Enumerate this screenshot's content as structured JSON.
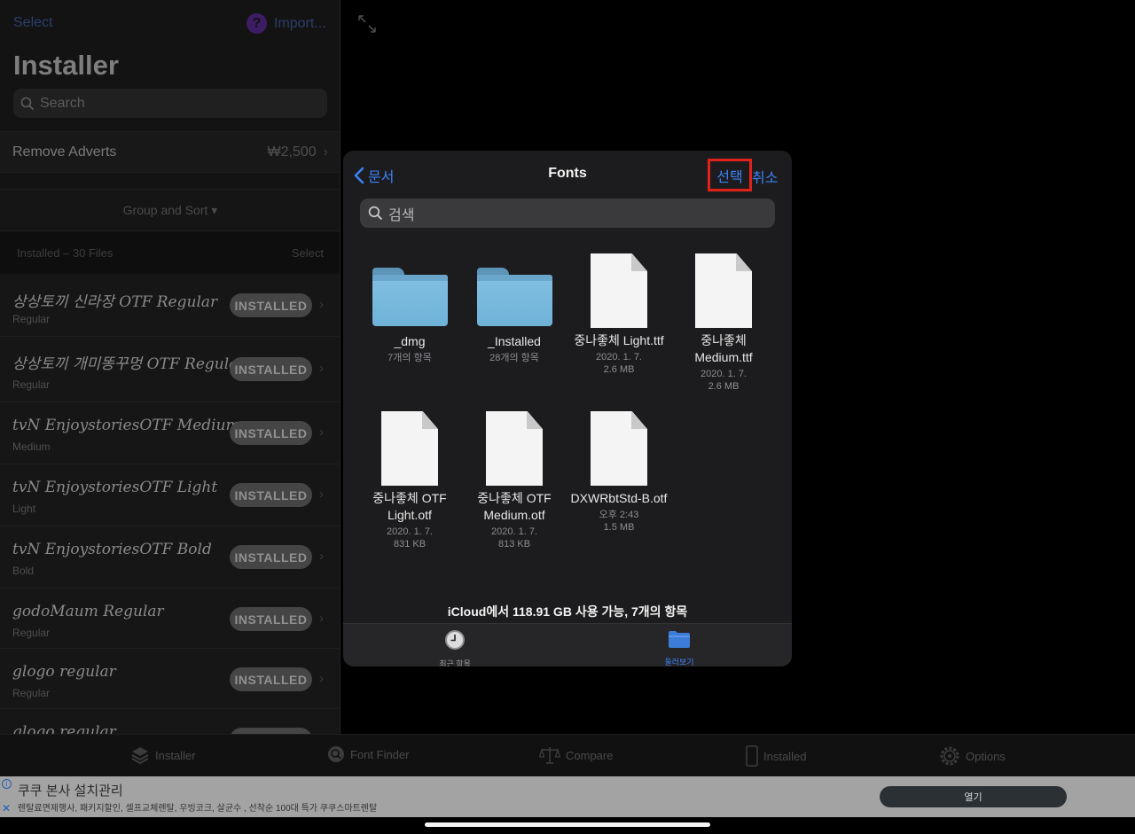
{
  "left_panel": {
    "select_label": "Select",
    "import_label": "Import...",
    "import_icon_glyph": "?",
    "title": "Installer",
    "search_placeholder": "Search",
    "remove_ads": {
      "label": "Remove Adverts",
      "price": "₩2,500"
    },
    "group_sort_label": "Group and Sort ▾",
    "files_header": {
      "count_label": "Installed – 30 Files",
      "select_label": "Select"
    },
    "fonts": [
      {
        "name": "상상토끼 신라장 OTF Regular",
        "style": "Regular",
        "status": "INSTALLED"
      },
      {
        "name": "상상토끼 개미똥꾸멍 OTF Regular",
        "style": "Regular",
        "status": "INSTALLED"
      },
      {
        "name": "tvN EnjoystoriesOTF Medium",
        "style": "Medium",
        "status": "INSTALLED"
      },
      {
        "name": "tvN EnjoystoriesOTF Light",
        "style": "Light",
        "status": "INSTALLED"
      },
      {
        "name": "tvN EnjoystoriesOTF Bold",
        "style": "Bold",
        "status": "INSTALLED"
      },
      {
        "name": "godoMaum Regular",
        "style": "Regular",
        "status": "INSTALLED"
      },
      {
        "name": "glogo regular",
        "style": "Regular",
        "status": "INSTALLED"
      },
      {
        "name": "glogo regular",
        "style": "",
        "status": ""
      }
    ]
  },
  "dialog": {
    "back_label": "문서",
    "title": "Fonts",
    "select_label": "선택",
    "cancel_label": "취소",
    "search_placeholder": "검색",
    "items": [
      {
        "kind": "folder",
        "name": "_dmg",
        "meta1": "7개의 항목",
        "meta2": ""
      },
      {
        "kind": "folder",
        "name": "_Installed",
        "meta1": "28개의 항목",
        "meta2": ""
      },
      {
        "kind": "file",
        "name": "중나좋체 Light.ttf",
        "meta1": "2020. 1. 7.",
        "meta2": "2.6 MB"
      },
      {
        "kind": "file",
        "name": "중나좋체 Medium.ttf",
        "meta1": "2020. 1. 7.",
        "meta2": "2.6 MB"
      },
      {
        "kind": "file",
        "name": "중나좋체 OTF Light.otf",
        "meta1": "2020. 1. 7.",
        "meta2": "831 KB"
      },
      {
        "kind": "file",
        "name": "중나좋체 OTF Medium.otf",
        "meta1": "2020. 1. 7.",
        "meta2": "813 KB"
      },
      {
        "kind": "file",
        "name": "DXWRbtStd-B.otf",
        "meta1": "오후 2:43",
        "meta2": "1.5 MB"
      }
    ],
    "storage_text": "iCloud에서 118.91 GB 사용 가능, 7개의 항목",
    "tabs": [
      {
        "label": "최근 항목",
        "icon": "clock-icon"
      },
      {
        "label": "둘러보기",
        "icon": "folder-icon"
      }
    ]
  },
  "app_tabbar": [
    {
      "label": "Installer",
      "icon": "layers-icon"
    },
    {
      "label": "Font Finder",
      "icon": "search-icon"
    },
    {
      "label": "Compare",
      "icon": "scale-icon"
    },
    {
      "label": "Installed",
      "icon": "device-icon"
    },
    {
      "label": "Options",
      "icon": "gear-icon"
    }
  ],
  "ad": {
    "title": "쿠쿠 본사 설치관리",
    "description": "렌탈료면제행사, 패키지할인, 셀프교체렌탈, 우빙코크, 살균수 , 선착순 100대 특가 쿠쿠스마트렌탈",
    "open_label": "열기",
    "close_glyph": "✕",
    "info_glyph": "i"
  },
  "colors": {
    "accent_blue": "#3b82f6",
    "highlight_red": "#e0221b",
    "folder_blue": "#79b8de"
  }
}
